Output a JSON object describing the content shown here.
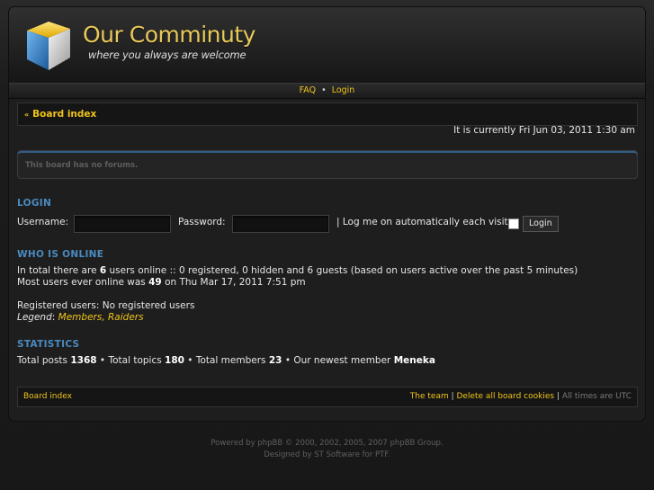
{
  "header": {
    "logo_title": "Our Comminuty",
    "logo_subtitle": "where you always are welcome"
  },
  "navbar": {
    "faq": "FAQ",
    "separator": "•",
    "login": "Login"
  },
  "breadcrumb": {
    "arrow": "«",
    "label": "Board index"
  },
  "current_time": "It is currently Fri Jun 03, 2011 1:30 am",
  "forums_message": "This board has no forums.",
  "login_section": {
    "title": "LOGIN",
    "username_label": "Username:",
    "password_label": "Password:",
    "remember_label": "| Log me on automatically each visit",
    "button": "Login"
  },
  "who_is_online": {
    "title": "WHO IS ONLINE",
    "line1_a": "In total there are ",
    "line1_count": "6",
    "line1_b": " users online :: 0 registered, 0 hidden and 6 guests (based on users active over the past 5 minutes)",
    "line2_a": "Most users ever online was ",
    "line2_count": "49",
    "line2_b": " on Thu Mar 17, 2011 7:51 pm",
    "registered": "Registered users: No registered users",
    "legend_label": "Legend",
    "legend_sep": ": ",
    "legend_members": "Members",
    "legend_comma": ", ",
    "legend_raiders": "Raiders"
  },
  "statistics": {
    "title": "STATISTICS",
    "posts_label": "Total posts ",
    "posts": "1368",
    "topics_label": " • Total topics ",
    "topics": "180",
    "members_label": " • Total members ",
    "members": "23",
    "newest_label": " • Our newest member ",
    "newest": "Meneka"
  },
  "footer": {
    "board_index": "Board index",
    "team": "The team",
    "sep": " | ",
    "delete_cookies": "Delete all board cookies",
    "times": "All times are UTC"
  },
  "copyright": {
    "line1": "Powered by phpBB © 2000, 2002, 2005, 2007 phpBB Group.",
    "line2": "Designed by ST Software for PTF."
  },
  "colors": {
    "accent": "#f0c419",
    "section_title": "#4a8ac0",
    "background": "#1e1e1e"
  }
}
